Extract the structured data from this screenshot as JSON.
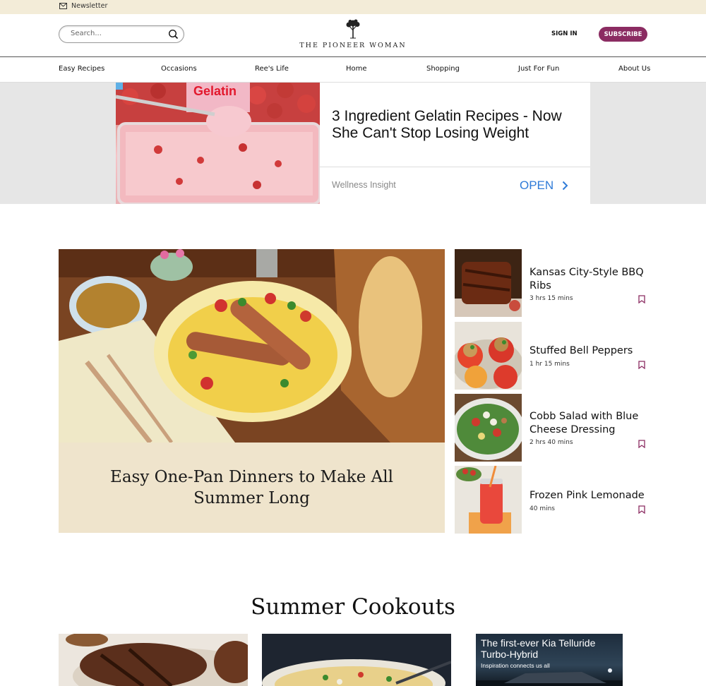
{
  "topbar": {
    "newsletter_label": "Newsletter"
  },
  "header": {
    "search_placeholder": "Search...",
    "logo_text": "THE PIONEER WOMAN",
    "signin_label": "SIGN IN",
    "subscribe_label": "SUBSCRIBE",
    "brand_color": "#8b2c62"
  },
  "nav": {
    "items": [
      {
        "label": "Easy Recipes"
      },
      {
        "label": "Occasions"
      },
      {
        "label": "Ree's Life"
      },
      {
        "label": "Home"
      },
      {
        "label": "Shopping"
      },
      {
        "label": "Just For Fun"
      },
      {
        "label": "About Us"
      }
    ]
  },
  "ad": {
    "title": "3 Ingredient Gelatin Recipes - Now She Can't Stop Losing Weight",
    "source": "Wellness Insight",
    "open_label": "OPEN",
    "image_text": "Gelatin",
    "accent_color": "#2f7bd8"
  },
  "featured": {
    "title": "Easy One-Pan Dinners to Make All Summer Long"
  },
  "side_list": [
    {
      "title": "Kansas City-Style BBQ Ribs",
      "time": "3 hrs 15 mins"
    },
    {
      "title": "Stuffed Bell Peppers",
      "time": "1 hr 15 mins"
    },
    {
      "title": "Cobb Salad with Blue Cheese Dressing",
      "time": "2 hrs 40 mins"
    },
    {
      "title": "Frozen Pink Lemonade",
      "time": "40 mins"
    }
  ],
  "section": {
    "title": "Summer Cookouts"
  },
  "kia_ad": {
    "title": "The first-ever Kia Telluride Turbo-Hybrid",
    "subtitle": "Inspiration connects us all"
  }
}
